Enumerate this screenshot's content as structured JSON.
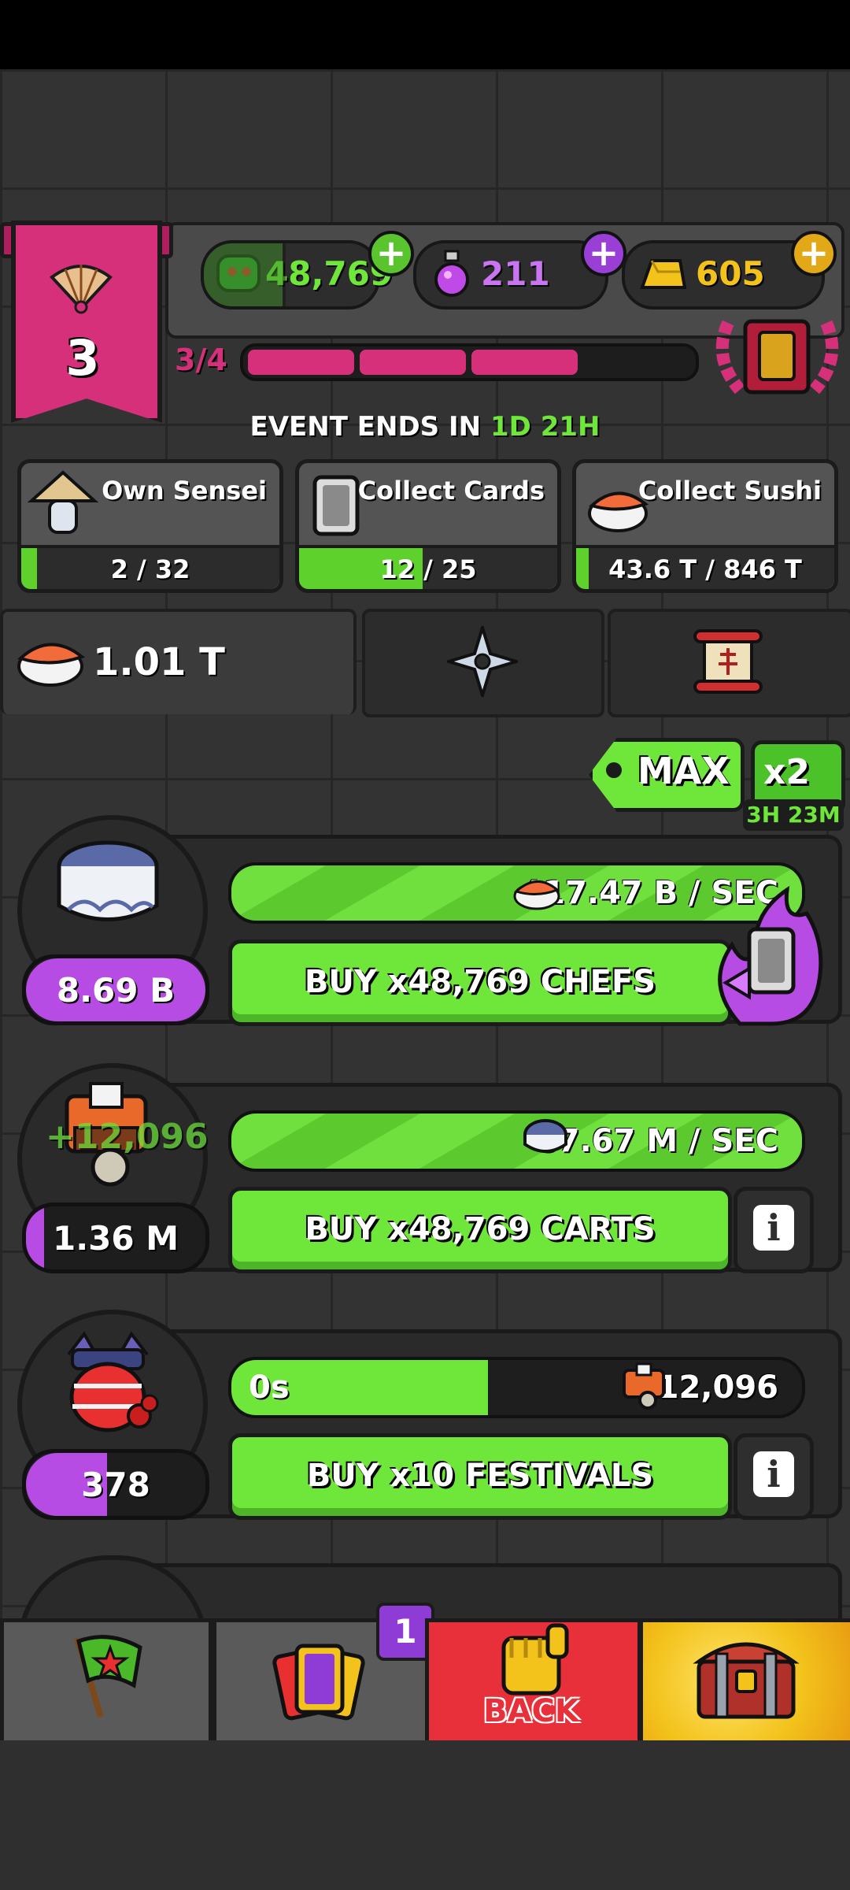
{
  "header": {
    "level": "3",
    "level_progress": "3/4",
    "level_progress_fraction": 0.75,
    "currencies": {
      "green_value": "48,769",
      "potion_value": "211",
      "gold_value": "605"
    }
  },
  "event": {
    "label": "EVENT ENDS IN",
    "time_days": "1D",
    "time_hours": "21H"
  },
  "quests": [
    {
      "title": "Own Sensei",
      "progress": "2 / 32",
      "fraction": 0.06
    },
    {
      "title": "Collect Cards",
      "progress": "12 / 25",
      "fraction": 0.48
    },
    {
      "title": "Collect Sushi",
      "progress": "43.6 T / 846 T",
      "fraction": 0.05
    }
  ],
  "sushi_total": "1.01 T",
  "boost": {
    "max_label": "MAX",
    "x2_label": "x2",
    "x2_time": "3H 23M"
  },
  "rows": [
    {
      "income": "417.47 B / SEC",
      "income_fraction": 1.0,
      "buy_label": "BUY x48,769 CHEFS",
      "cost": "8.69 B",
      "cost_fraction": 1.0
    },
    {
      "income": "87.67 M / SEC",
      "income_fraction": 1.0,
      "buy_label": "BUY x48,769 CARTS",
      "cost": "1.36 M",
      "cost_fraction": 0.1,
      "floating_text": "+12,096"
    },
    {
      "timer": "0s",
      "income": "12,096",
      "income_fraction": 0.45,
      "buy_label": "BUY x10 FESTIVALS",
      "cost": "378",
      "cost_fraction": 0.45
    }
  ],
  "nav": {
    "cards_badge": "1",
    "back_label": "BACK"
  },
  "colors": {
    "accent_green": "#6ee63a",
    "pink": "#d6307a",
    "purple": "#b64ce3",
    "back_red": "#e8303a",
    "gold": "#f3c21b"
  }
}
